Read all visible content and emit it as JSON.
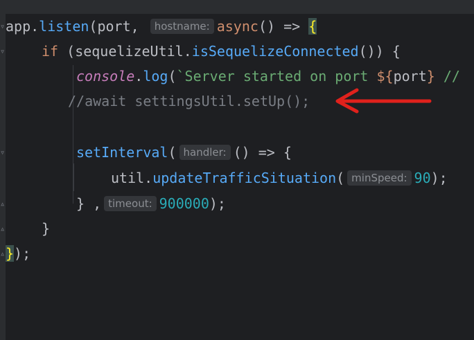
{
  "editor": {
    "line1": {
      "obj": "app",
      "dot": ".",
      "method": "listen",
      "open": "(",
      "arg": "port,",
      "hint": "hostname:",
      "async_kw": "async",
      "parens": "()",
      "arrow": " => ",
      "brace": "{"
    },
    "line2": {
      "kw": "if",
      "open": " (",
      "obj": "sequelizeUtil",
      "dot": ".",
      "method": "isSequelizeConnected",
      "close": "()) {"
    },
    "line3": {
      "obj": "console",
      "dot": ".",
      "method": "log",
      "open": "(",
      "str": "`Server started on port ",
      "tmpl_open": "${",
      "tmpl_var": "port",
      "tmpl_close": "}",
      "rest": " //"
    },
    "line4": {
      "comment": "//await settingsUtil.setUp();"
    },
    "line5": {
      "method": "setInterval",
      "open": "(",
      "hint": "handler:",
      "rest": "() => {"
    },
    "line6": {
      "obj": "util",
      "dot": ".",
      "method": "updateTrafficSituation",
      "open": "(",
      "hint": "minSpeed:",
      "num": "90",
      "close": ");"
    },
    "line7": {
      "close": "} ,",
      "hint": "timeout:",
      "num": "900000",
      "end": ");"
    },
    "line8": {
      "close": "}"
    },
    "line9": {
      "brace": "}",
      "end": ");"
    }
  },
  "annotation": {
    "arrow_color": "#e0211c"
  }
}
